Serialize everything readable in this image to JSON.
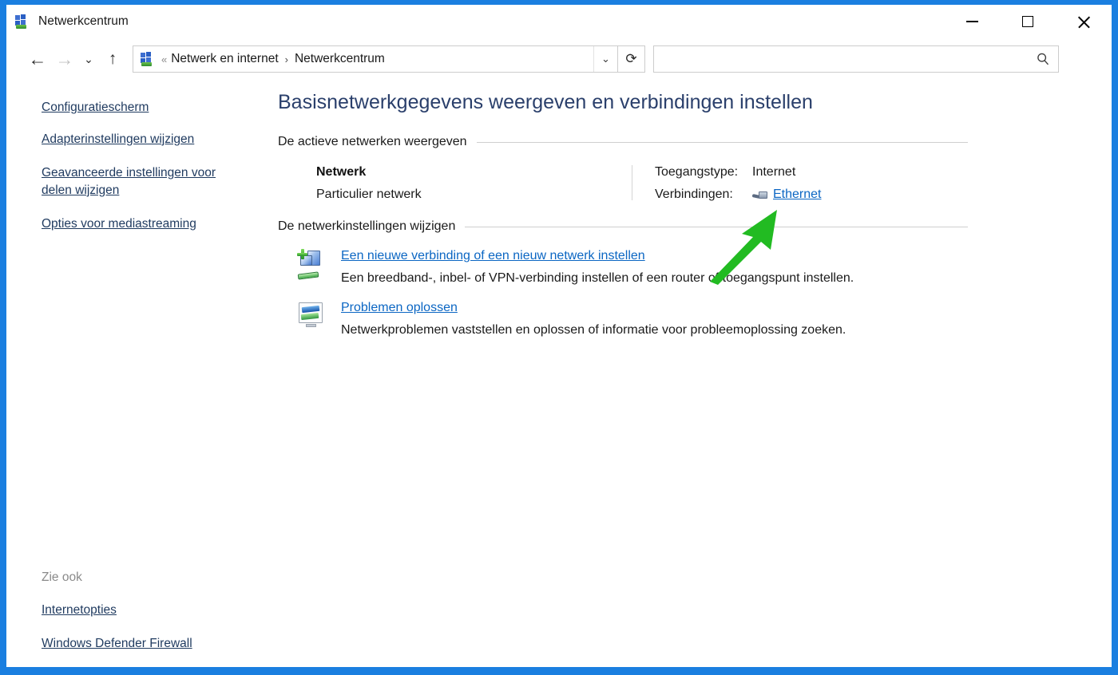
{
  "window": {
    "title": "Netwerkcentrum",
    "icon": "network-center-icon",
    "border_color": "#1a7fe0",
    "controls": {
      "minimize": "minimize-icon",
      "maximize": "maximize-icon",
      "close": "close-icon"
    }
  },
  "navbar": {
    "back": "back-arrow-icon",
    "forward": "forward-arrow-icon",
    "history_dropdown": "chevron-down-icon",
    "up": "up-arrow-icon",
    "breadcrumb": {
      "icon": "network-center-icon",
      "lead_separator": "«",
      "items": [
        "Netwerk en internet",
        "Netwerkcentrum"
      ],
      "separator": "›",
      "dropdown": "chevron-down-icon"
    },
    "refresh": "refresh-icon",
    "search": {
      "value": "",
      "placeholder": "",
      "icon": "search-icon"
    }
  },
  "sidebar": {
    "top_link": "Configuratiescherm",
    "links": [
      "Adapterinstellingen wijzigen",
      "Geavanceerde instellingen voor delen wijzigen",
      "Opties voor mediastreaming"
    ],
    "see_also": {
      "label": "Zie ook",
      "links": [
        "Internetopties",
        "Windows Defender Firewall"
      ]
    }
  },
  "main": {
    "heading": "Basisnetwerkgegevens weergeven en verbindingen instellen",
    "active_networks": {
      "section_title": "De actieve netwerken weergeven",
      "network_name": "Netwerk",
      "network_type": "Particulier netwerk",
      "details": [
        {
          "label": "Toegangstype:",
          "value": "Internet",
          "is_link": false,
          "icon": ""
        },
        {
          "label": "Verbindingen:",
          "value": "Ethernet",
          "is_link": true,
          "icon": "ethernet-icon"
        }
      ]
    },
    "change_settings": {
      "section_title": "De netwerkinstellingen wijzigen",
      "items": [
        {
          "icon": "new-connection-icon",
          "link": "Een nieuwe verbinding of een nieuw netwerk instellen",
          "description": "Een breedband-, inbel- of VPN-verbinding instellen of een router of toegangspunt instellen."
        },
        {
          "icon": "troubleshoot-icon",
          "link": "Problemen oplossen",
          "description": "Netwerkproblemen vaststellen en oplossen of informatie voor probleemoplossing zoeken."
        }
      ]
    }
  },
  "annotation": {
    "arrow": "green-arrow-pointing-to-ethernet-link",
    "color": "#22bb22"
  }
}
